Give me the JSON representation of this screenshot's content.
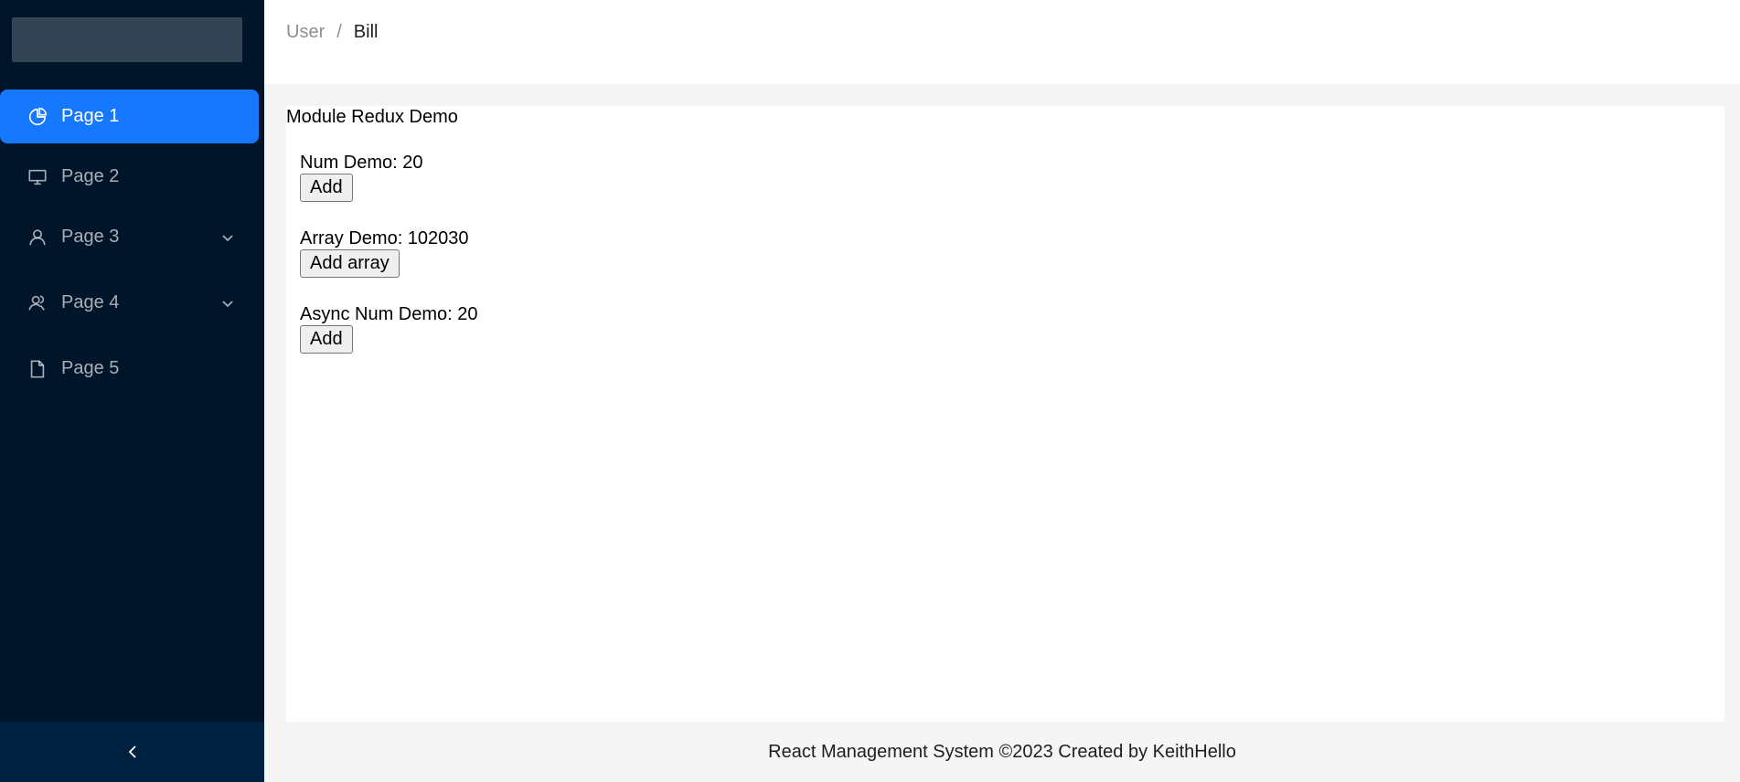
{
  "sidebar": {
    "items": [
      {
        "label": "Page 1",
        "icon": "pie-chart-icon",
        "active": true
      },
      {
        "label": "Page 2",
        "icon": "desktop-icon",
        "active": false
      },
      {
        "label": "Page 3",
        "icon": "user-icon",
        "active": false,
        "has_submenu": true
      },
      {
        "label": "Page 4",
        "icon": "team-icon",
        "active": false,
        "has_submenu": true
      },
      {
        "label": "Page 5",
        "icon": "file-icon",
        "active": false
      }
    ],
    "colors": {
      "background": "#001529",
      "active": "#1677ff",
      "collapse_bar": "#002140"
    }
  },
  "breadcrumb": {
    "items": [
      "User",
      "Bill"
    ],
    "separator": "/"
  },
  "main": {
    "title": "Module Redux Demo",
    "num_demo": {
      "label": "Num Demo: 20",
      "button": "Add"
    },
    "array_demo": {
      "label": "Array Demo: 102030",
      "button": "Add array"
    },
    "async_demo": {
      "label": "Async Num Demo: 20",
      "button": "Add"
    }
  },
  "footer": {
    "text": "React Management System ©2023 Created by KeithHello"
  }
}
